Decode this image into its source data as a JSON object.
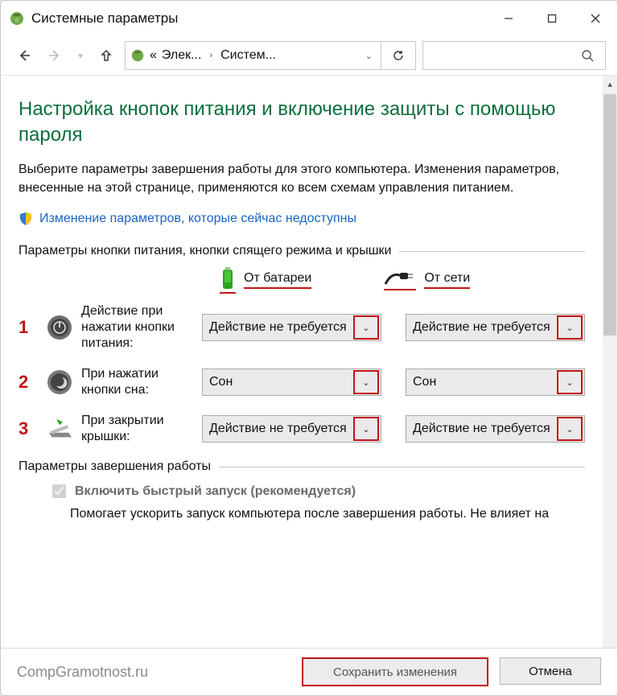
{
  "window_title": "Системные параметры",
  "breadcrumb": {
    "prefix": "«",
    "seg1": "Элек...",
    "seg2": "Систем..."
  },
  "heading": "Настройка кнопок питания и включение защиты с помощью пароля",
  "description": "Выберите параметры завершения работы для этого компьютера. Изменения параметров, внесенные на этой странице, применяются ко всем схемам управления питанием.",
  "change_link": "Изменение параметров, которые сейчас недоступны",
  "section1_title": "Параметры кнопки питания, кнопки спящего режима и крышки",
  "columns": {
    "battery": "От батареи",
    "plugged": "От сети"
  },
  "rows": [
    {
      "num": "1",
      "label": "Действие при нажатии кнопки питания:",
      "battery": "Действие не требуется",
      "plugged": "Действие не требуется"
    },
    {
      "num": "2",
      "label": "При нажатии кнопки сна:",
      "battery": "Сон",
      "plugged": "Сон"
    },
    {
      "num": "3",
      "label": "При закрытии крышки:",
      "battery": "Действие не требуется",
      "plugged": "Действие не требуется"
    }
  ],
  "section2_title": "Параметры завершения работы",
  "fast_startup_label": "Включить быстрый запуск (рекомендуется)",
  "fast_startup_hint": "Помогает ускорить запуск компьютера после завершения работы. Не влияет на",
  "footer_brand": "CompGramotnost.ru",
  "save_button": "Сохранить изменения",
  "cancel_button": "Отмена"
}
